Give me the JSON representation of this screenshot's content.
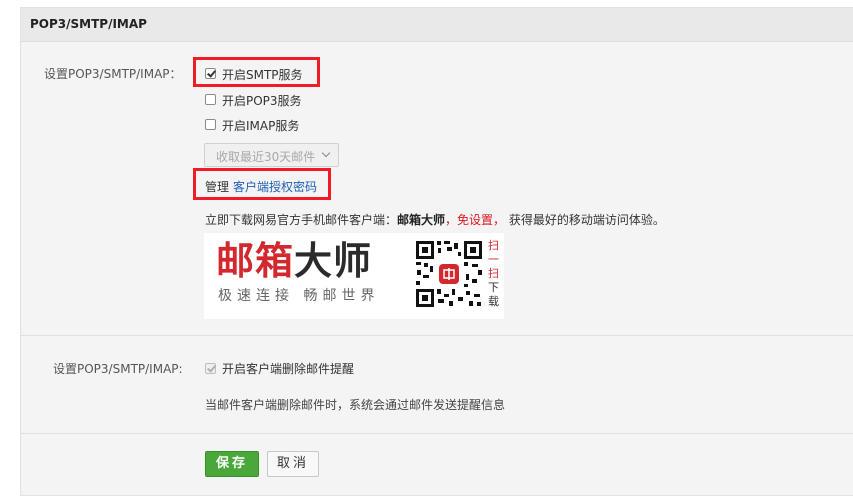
{
  "header": {
    "title": "POP3/SMTP/IMAP"
  },
  "section1": {
    "label": "设置POP3/SMTP/IMAP：",
    "options": [
      {
        "label": "开启SMTP服务",
        "checked": true
      },
      {
        "label": "开启POP3服务",
        "checked": false
      },
      {
        "label": "开启IMAP服务",
        "checked": false
      }
    ],
    "fetch_select": {
      "value": "收取最近30天邮件"
    },
    "manage": {
      "prefix": "管理",
      "link": "客户端授权密码"
    },
    "promo": {
      "text_before": "立即下载网易官方手机邮件客户端：",
      "app_name": "邮箱大师",
      "highlight": "，免设置，",
      "text_after": " 获得最好的移动端访问体验。"
    },
    "ad": {
      "title_red": "邮箱",
      "title_black": "大师",
      "slogan": "极速连接  畅邮世界",
      "qr_text": [
        "扫",
        "一",
        "扫",
        "下",
        "载"
      ]
    }
  },
  "section2": {
    "label": "设置POP3/SMTP/IMAP:",
    "option": {
      "label": "开启客户端删除邮件提醒",
      "checked": true,
      "disabled": true
    },
    "description": "当邮件客户端删除邮件时，系统会通过邮件发送提醒信息"
  },
  "actions": {
    "save": "保存",
    "cancel": "取消"
  },
  "colors": {
    "highlight_box": "#ee1c25",
    "link": "#1d5fb6",
    "save_button": "#4aa83a"
  }
}
